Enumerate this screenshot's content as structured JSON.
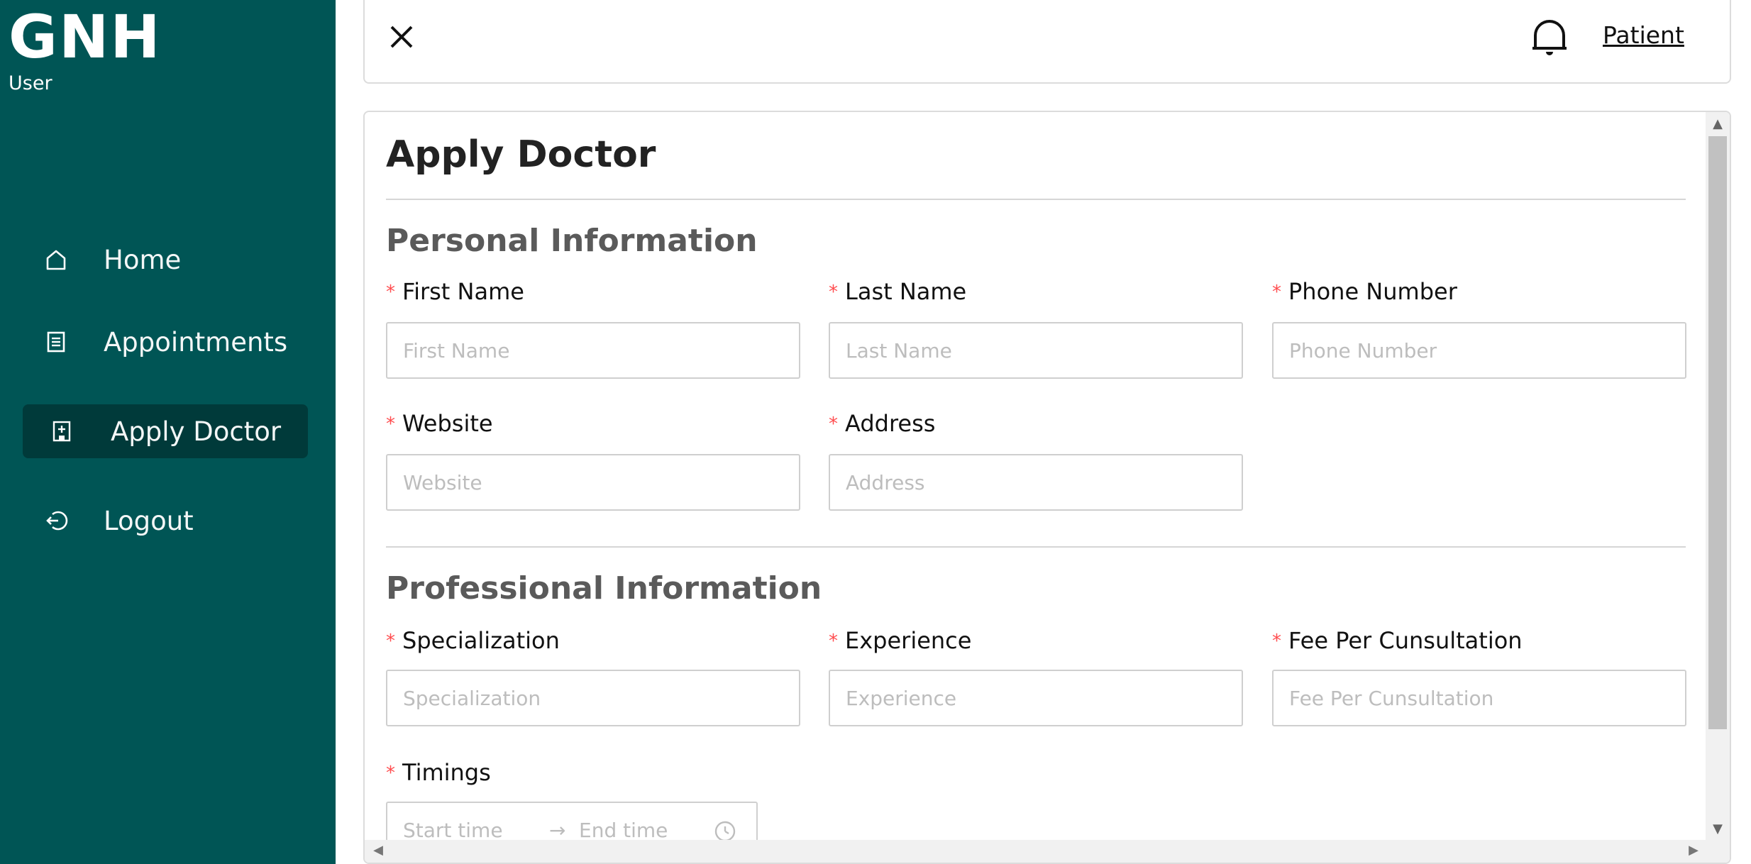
{
  "brand": {
    "name": "GNH",
    "role": "User"
  },
  "sidebar": {
    "items": [
      {
        "label": "Home",
        "icon": "home-icon",
        "active": false
      },
      {
        "label": "Appointments",
        "icon": "list-icon",
        "active": false
      },
      {
        "label": "Apply Doctor",
        "icon": "hospital-icon",
        "active": true
      },
      {
        "label": "Logout",
        "icon": "logout-icon",
        "active": false
      }
    ]
  },
  "header": {
    "user_link": "Patient"
  },
  "form": {
    "title": "Apply Doctor",
    "personal": {
      "title": "Personal Information",
      "fields": [
        {
          "label": "First Name",
          "placeholder": "First Name",
          "value": ""
        },
        {
          "label": "Last Name",
          "placeholder": "Last Name",
          "value": ""
        },
        {
          "label": "Phone Number",
          "placeholder": "Phone Number",
          "value": ""
        },
        {
          "label": "Website",
          "placeholder": "Website",
          "value": ""
        },
        {
          "label": "Address",
          "placeholder": "Address",
          "value": ""
        }
      ]
    },
    "professional": {
      "title": "Professional Information",
      "fields": [
        {
          "label": "Specialization",
          "placeholder": "Specialization",
          "value": ""
        },
        {
          "label": "Experience",
          "placeholder": "Experience",
          "value": ""
        },
        {
          "label": "Fee Per Cunsultation",
          "placeholder": "Fee Per Cunsultation",
          "value": ""
        }
      ],
      "timings": {
        "label": "Timings",
        "start_placeholder": "Start time",
        "end_placeholder": "End time",
        "separator": "→"
      }
    },
    "required_mark": "*"
  },
  "colors": {
    "sidebar": "#005555",
    "active_item": "#003a3a",
    "required": "#ff4d4f"
  }
}
